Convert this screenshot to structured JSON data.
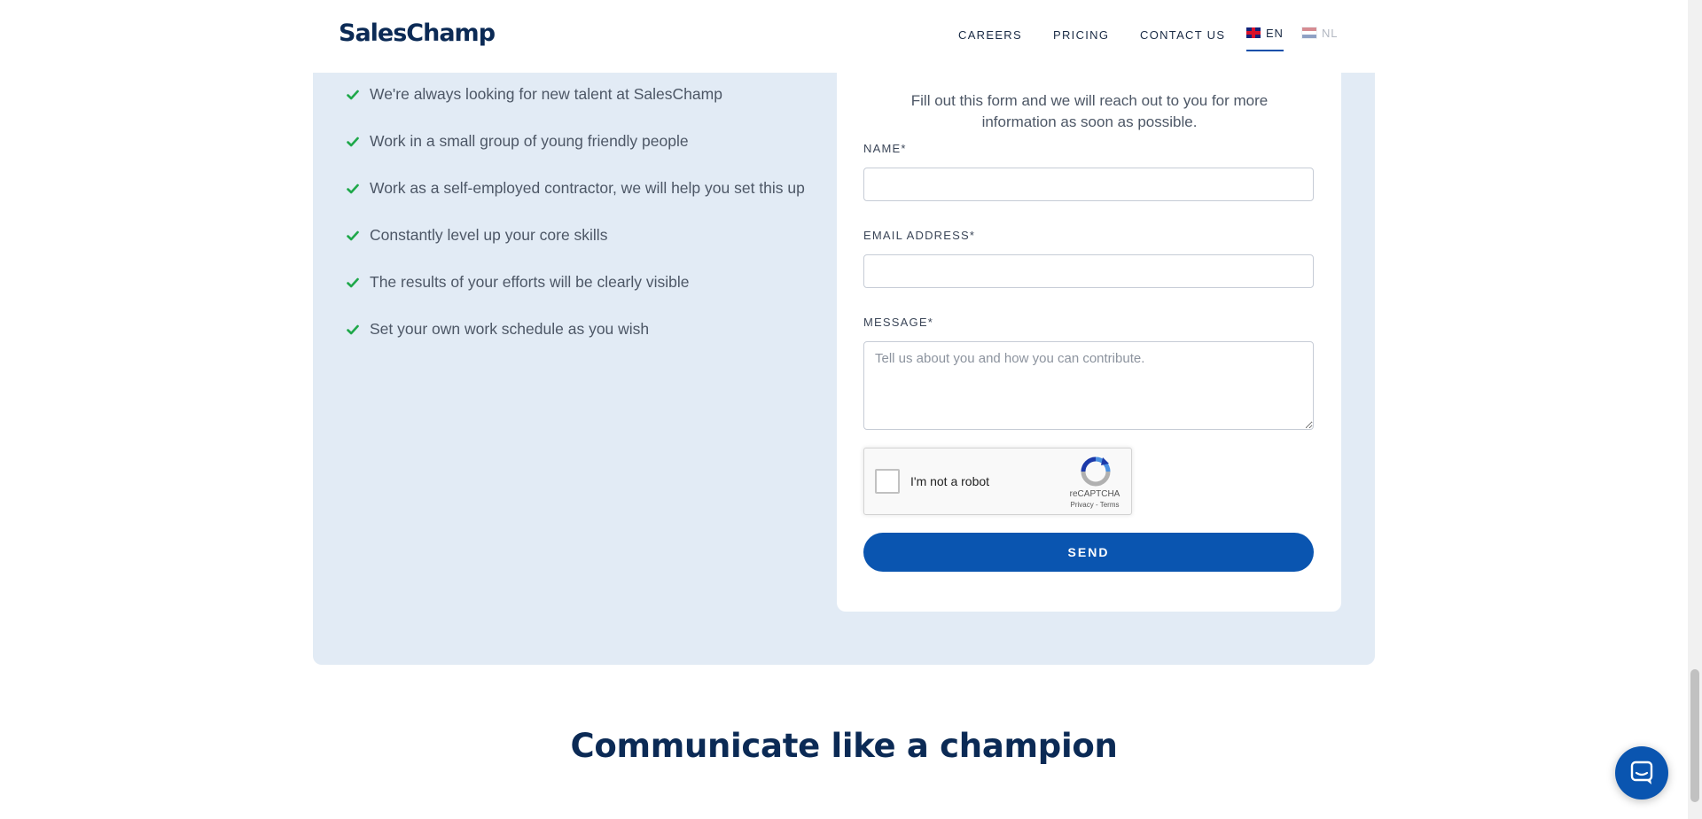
{
  "header": {
    "logo": "SalesChamp",
    "nav": [
      "CAREERS",
      "PRICING",
      "CONTACT US"
    ],
    "languages": [
      {
        "code": "EN",
        "flag": "uk-flag-icon",
        "active": true
      },
      {
        "code": "NL",
        "flag": "nl-flag-icon",
        "active": false
      }
    ]
  },
  "benefits": [
    "We're always looking for new talent at SalesChamp",
    "Work in a small group of young friendly people",
    "Work as a self-employed contractor, we will help you set this up",
    "Constantly level up your core skills",
    "The results of your efforts will be clearly visible",
    "Set your own work schedule as you wish"
  ],
  "form": {
    "subtitle": "Fill out this form and we will reach out to you for more information as soon as possible.",
    "name_label": "NAME*",
    "name_value": "",
    "email_label": "EMAIL ADDRESS*",
    "email_value": "",
    "message_label": "MESSAGE*",
    "message_placeholder": "Tell us about you and how you can contribute.",
    "message_value": "",
    "recaptcha": {
      "label": "I'm not a robot",
      "brand": "reCAPTCHA",
      "terms": "Privacy - Terms",
      "checked": false
    },
    "send_label": "SEND"
  },
  "section_heading": "Communicate like a champion",
  "colors": {
    "brand_navy": "#0b2a55",
    "accent_blue": "#0a55b0",
    "panel_bg": "#e2ebf5",
    "check_green": "#1fa84a"
  },
  "icons": {
    "check": "check-icon",
    "recaptcha": "recaptcha-logo-icon",
    "chat": "chat-icon"
  }
}
